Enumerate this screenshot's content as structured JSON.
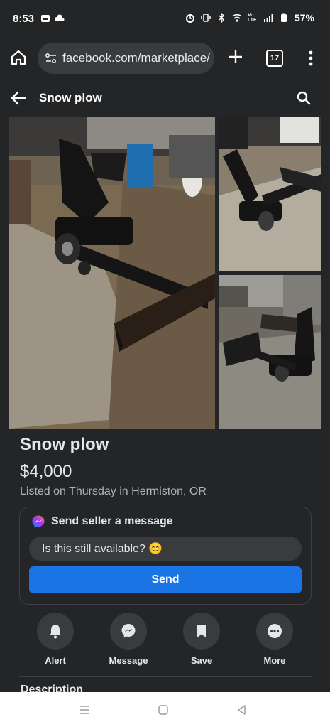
{
  "status_bar": {
    "time": "8:53",
    "battery": "57%",
    "lte_label": "Vo LTE",
    "icons": [
      "gallery-icon",
      "cloud-icon",
      "alarm-icon",
      "vibrate-icon",
      "bluetooth-icon",
      "wifi-icon",
      "signal-icon",
      "battery-icon"
    ]
  },
  "browser": {
    "url": "facebook.com/marketplace/i",
    "tab_count": "17",
    "icons": [
      "home-icon",
      "site-settings-icon",
      "new-tab-icon",
      "tabs-icon",
      "more-vert-icon"
    ]
  },
  "app_bar": {
    "title": "Snow plow",
    "icons": [
      "back-arrow-icon",
      "search-icon"
    ]
  },
  "listing": {
    "title": "Snow plow",
    "price": "$4,000",
    "meta": "Listed on Thursday in Hermiston, OR",
    "photos": [
      "photo-1",
      "photo-2",
      "photo-3"
    ]
  },
  "message_card": {
    "heading": "Send seller a message",
    "input_value": "Is this still available? 😊",
    "send_label": "Send"
  },
  "actions": [
    {
      "label": "Alert",
      "icon": "bell-icon"
    },
    {
      "label": "Message",
      "icon": "messenger-icon"
    },
    {
      "label": "Save",
      "icon": "bookmark-icon"
    },
    {
      "label": "More",
      "icon": "more-horiz-icon"
    }
  ],
  "description": {
    "heading": "Description"
  },
  "colors": {
    "background": "#242526",
    "accent": "#1b74e4",
    "text": "#e4e6eb",
    "secondary_text": "#b0b3b8"
  },
  "nav_bar": {
    "icons": [
      "recent-apps-icon",
      "home-nav-icon",
      "back-nav-icon"
    ]
  }
}
